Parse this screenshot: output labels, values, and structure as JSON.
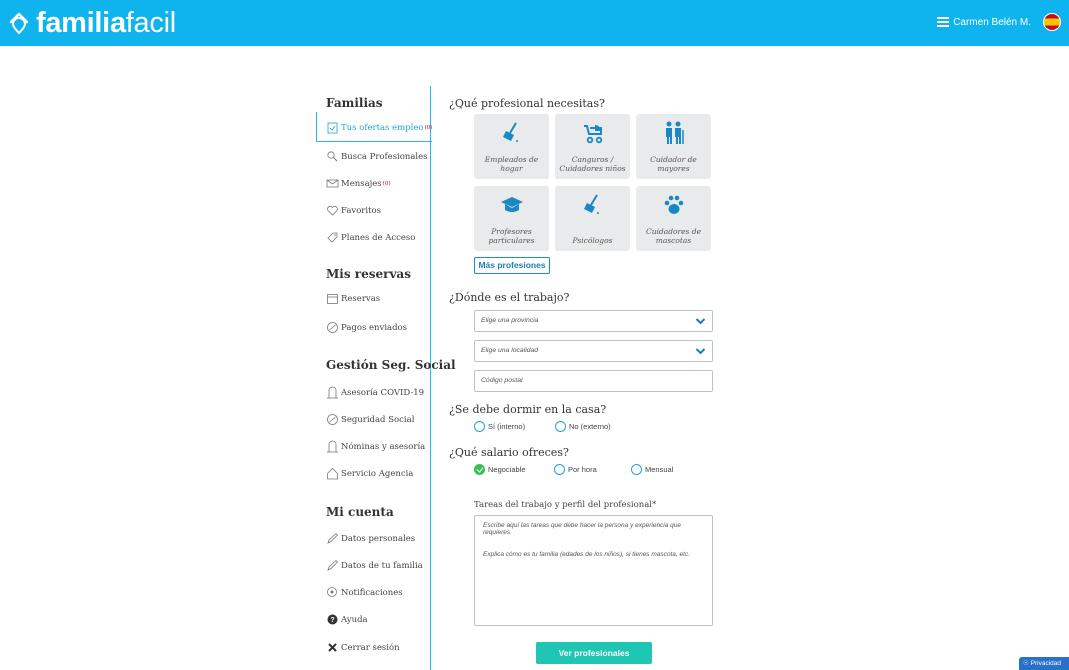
{
  "header": {
    "logo_icon": "house-pin-icon",
    "logo_bold": "familia",
    "logo_light": "facil",
    "menu_icon": "hamburger-icon",
    "user_name": "Carmen Belén M.",
    "flag_icon": "spain-flag-icon",
    "colors": {
      "bar": "#0fb4ee"
    }
  },
  "sidebar": {
    "sections": [
      {
        "title": "Familias"
      },
      {
        "title": "Mis reservas"
      },
      {
        "title": "Gestión Seg. Social"
      },
      {
        "title": "Mi cuenta"
      }
    ],
    "items": [
      {
        "label": "Tus ofertas empleo",
        "badge": "(0)",
        "icon": "clipboard-icon"
      },
      {
        "label": "Busca Profesionales",
        "badge": "",
        "icon": "search-people-icon"
      },
      {
        "label": "Mensajes",
        "badge": "(0)",
        "icon": "envelope-icon"
      },
      {
        "label": "Favoritos",
        "badge": "",
        "icon": "heart-icon"
      },
      {
        "label": "Planes de Acceso",
        "badge": "",
        "icon": "tag-icon"
      },
      {
        "label": "Reservas",
        "badge": "",
        "icon": "calendar-icon"
      },
      {
        "label": "Pagos enviados",
        "badge": "",
        "icon": "payment-icon"
      },
      {
        "label": "Asesoría COVID-19",
        "badge": "",
        "icon": "advisor-icon"
      },
      {
        "label": "Seguridad Social",
        "badge": "",
        "icon": "payment-icon"
      },
      {
        "label": "Nóminas y asesoría",
        "badge": "",
        "icon": "advisor-icon"
      },
      {
        "label": "Servicio Agencia",
        "badge": "",
        "icon": "house-icon"
      },
      {
        "label": "Datos personales",
        "badge": "",
        "icon": "pencil-icon"
      },
      {
        "label": "Datos de tu familia",
        "badge": "",
        "icon": "pencil-icon"
      },
      {
        "label": "Notificaciones",
        "badge": "",
        "icon": "bell-icon"
      },
      {
        "label": "Ayuda",
        "badge": "",
        "icon": "help-icon"
      },
      {
        "label": "Cerrar sesión",
        "badge": "",
        "icon": "close-icon"
      }
    ]
  },
  "main": {
    "q_profesional": "¿Qué profesional necesitas?",
    "cards": [
      {
        "label": "Empleados de hogar",
        "icon": "broom-icon"
      },
      {
        "label": "Canguros / Cuidadores niños",
        "icon": "stroller-icon"
      },
      {
        "label": "Cuidador de mayores",
        "icon": "elderly-couple-icon"
      },
      {
        "label": "Profesores particulares",
        "icon": "graduation-cap-icon"
      },
      {
        "label": "Psicólogos",
        "icon": "broom-icon"
      },
      {
        "label": "Cuidadores de mascotas",
        "icon": "paw-icon"
      }
    ],
    "more_button": "Más profesiones",
    "q_donde": "¿Dónde es el trabajo?",
    "provincia_placeholder": "Elige una provincia",
    "localidad_placeholder": "Elige una localidad",
    "cp_placeholder": "Código postal",
    "q_dormir": "¿Se debe dormir en la casa?",
    "dormir_options": [
      "Sí (interno)",
      "No (externo)"
    ],
    "q_salario": "¿Qué salario ofreces?",
    "salario_options": [
      "Negociable",
      "Por hora",
      "Mensual"
    ],
    "salario_selected": "Negociable",
    "tareas_label": "Tareas del trabajo y perfil del profesional*",
    "tareas_line1": "Escribe aquí las tareas que debe hacer la persona y experiencia que requieres",
    "tareas_line2": "Explica cómo es tu familia (edades de los niños), si tienes mascota, etc.",
    "submit_button": "Ver profesionales",
    "colors": {
      "accent": "#1aa3da",
      "submit": "#1fc6b3",
      "card": "#e9eaeb"
    }
  },
  "privacy": {
    "label": "Privacidad",
    "icon": "shield-icon"
  }
}
